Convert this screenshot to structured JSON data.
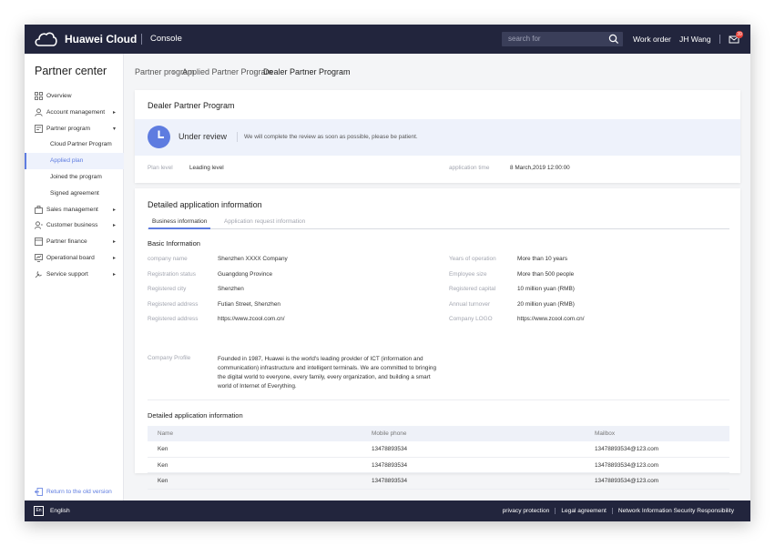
{
  "topbar": {
    "brand": "Huawei Cloud",
    "console": "Console",
    "search_placeholder": "search for",
    "work_order": "Work order",
    "user": "JH Wang",
    "mail_badge": "39"
  },
  "sidebar": {
    "title": "Partner center",
    "items": [
      {
        "label": "Overview",
        "icon": "grid-icon"
      },
      {
        "label": "Account management",
        "icon": "user-icon",
        "arrow": "▸"
      },
      {
        "label": "Partner program",
        "icon": "program-icon",
        "arrow": "▾"
      },
      {
        "label": "Cloud Partner Program"
      },
      {
        "label": "Applied plan"
      },
      {
        "label": "Joined the program"
      },
      {
        "label": "Signed agreement"
      },
      {
        "label": "Sales management",
        "icon": "briefcase-icon",
        "arrow": "▸"
      },
      {
        "label": "Customer business",
        "icon": "customer-icon",
        "arrow": "▸"
      },
      {
        "label": "Partner finance",
        "icon": "finance-icon",
        "arrow": "▸"
      },
      {
        "label": "Operational board",
        "icon": "board-icon",
        "arrow": "▸"
      },
      {
        "label": "Service support",
        "icon": "support-icon",
        "arrow": "▸"
      }
    ],
    "return_label": "Return to the old version"
  },
  "breadcrumb": [
    "Partner program",
    "Applied Partner Program",
    "Dealer Partner Program"
  ],
  "plan_card": {
    "title": "Dealer Partner Program",
    "status_title": "Under review",
    "status_message": "We will complete the review as soon as possible, please be patient.",
    "plan_level_label": "Plan level",
    "plan_level_value": "Leading level",
    "application_time_label": "application time",
    "application_time_value": "8 March,2019 12:00:00"
  },
  "detail_card": {
    "title": "Detailed application information",
    "tabs": [
      "Business information",
      "Application request information"
    ],
    "basic_title": "Basic Information",
    "left_fields": [
      {
        "label": "company name",
        "value": "Shenzhen XXXX Company"
      },
      {
        "label": "Registration status",
        "value": "Guangdong Province"
      },
      {
        "label": "Registered city",
        "value": "Shenzhen"
      },
      {
        "label": "Registered address",
        "value": "Futian Street, Shenzhen"
      },
      {
        "label": "Registered address",
        "value": "https://www.zcool.com.cn/"
      }
    ],
    "right_fields": [
      {
        "label": "Years of operation",
        "value": "More than 10 years"
      },
      {
        "label": "Employee size",
        "value": "More than 500 people"
      },
      {
        "label": "Registered capital",
        "value": "10 million yuan (RMB)"
      },
      {
        "label": "Annual turnover",
        "value": "20 million yuan (RMB)"
      },
      {
        "label": "Company LOGO",
        "value": "https://www.zcool.com.cn/"
      }
    ],
    "profile_label": "Company Profile",
    "profile_text": "Founded in 1987, Huawei is the world's leading provider of ICT (information and communication) infrastructure and intelligent terminals. We are committed to bringing the digital world to everyone, every family, every organization, and building a smart world of Internet of Everything.",
    "table_title": "Detailed application information",
    "table_headers": [
      "Name",
      "Mobile phone",
      "Mailbox"
    ],
    "table_rows": [
      [
        "Ken",
        "13478893534",
        "13478893534@123.com"
      ],
      [
        "Ken",
        "13478893534",
        "13478893534@123.com"
      ],
      [
        "Ken",
        "13478893534",
        "13478893534@123.com"
      ]
    ]
  },
  "footer": {
    "language": "English",
    "language_icon": "En",
    "links": [
      "privacy protection",
      "Legal agreement",
      "Network Information Security Responsibility"
    ]
  },
  "colors": {
    "accent": "#5e7ce0",
    "topbar": "#22253d",
    "badge": "#e8433a"
  }
}
